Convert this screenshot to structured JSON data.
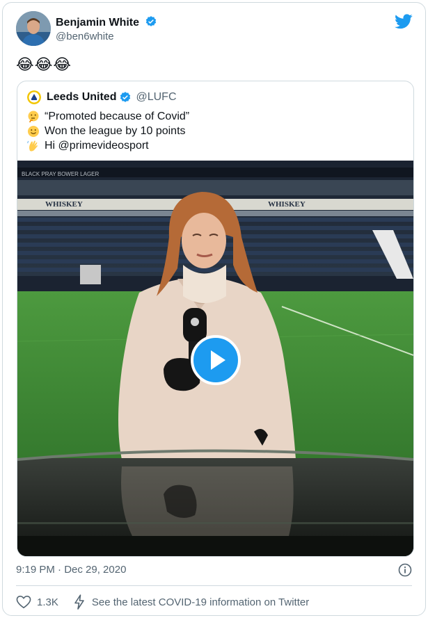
{
  "author": {
    "name": "Benjamin White",
    "handle": "@ben6white"
  },
  "tweet": {
    "text": "😂😂😂"
  },
  "quoted": {
    "name": "Leeds United",
    "handle": "@LUFC",
    "lines": [
      {
        "icon": "thinking-face-icon",
        "text": "“Promoted because of Covid”"
      },
      {
        "icon": "slightly-smiling-face-icon",
        "text": "Won the league by 10 points"
      },
      {
        "icon": "waving-hand-icon",
        "text": "Hi @primevideosport"
      }
    ]
  },
  "video": {
    "signage": [
      "BLACK PRAY BOWER LAGER",
      "WHISKEY",
      "WHISKEY"
    ]
  },
  "footer": {
    "timestamp": "9:19 PM · Dec 29, 2020",
    "likes": "1.3K",
    "covid_link": "See the latest COVID-19 information on Twitter"
  },
  "colors": {
    "accent": "#1d9bf0",
    "text": "#0f1419",
    "muted": "#536471",
    "border": "#cfd9de",
    "pitch": "#3f8a3a"
  }
}
